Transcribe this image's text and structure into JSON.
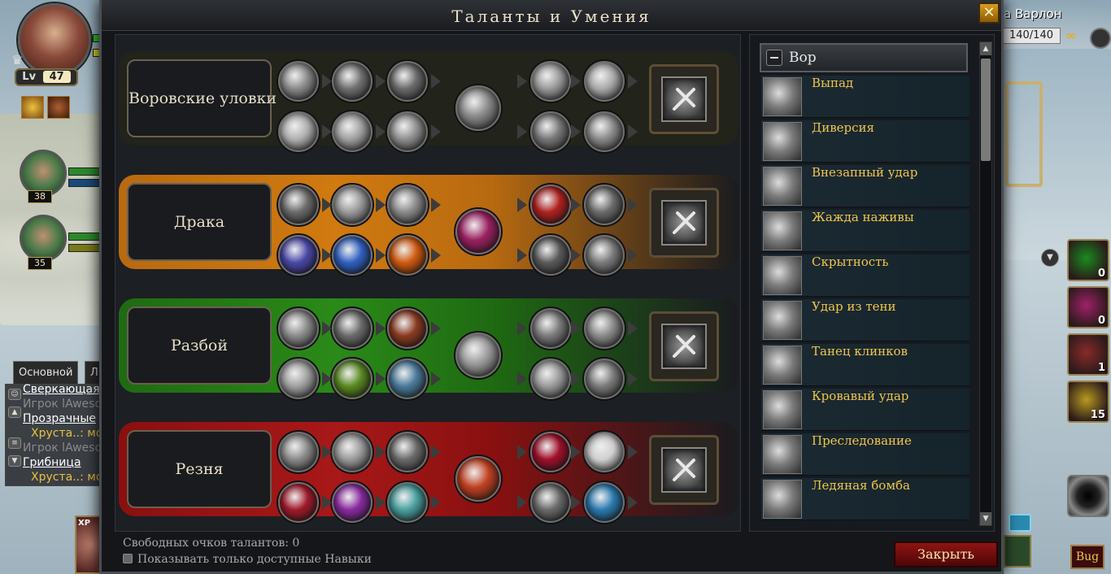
{
  "window": {
    "title": "Таланты и Умения",
    "close_glyph": "✕"
  },
  "player": {
    "level_prefix": "Lv",
    "level": "47"
  },
  "party": [
    {
      "level": "38"
    },
    {
      "level": "35"
    }
  ],
  "top_right": {
    "name_fragment": "а Варлон",
    "hp": "140/140"
  },
  "chat": {
    "tabs": [
      "Основной",
      "Л"
    ],
    "lines": [
      {
        "text": "Сверкающая",
        "color": "#ffffff",
        "underline": true
      },
      {
        "text": "Игрок lAweso",
        "color": "#8a8a8a",
        "underline": false
      },
      {
        "text": "Прозрачные",
        "color": "#ffffff",
        "underline": true
      },
      {
        "text": "Хруста..: мор",
        "color": "#e8c040",
        "underline": false
      },
      {
        "text": "Игрок lAweso",
        "color": "#8a8a8a",
        "underline": false
      },
      {
        "text": "Грибница",
        "color": "#ffffff",
        "underline": true
      },
      {
        "text": "Хруста..: мор",
        "color": "#e8c040",
        "underline": false
      }
    ]
  },
  "talent_trees": [
    {
      "name": "Воровские уловки",
      "color": "#2a2a1e",
      "accent": "#4b4a28"
    },
    {
      "name": "Драка",
      "color": "#b86a10",
      "accent": "#d07a10"
    },
    {
      "name": "Разбой",
      "color": "#1f6a12",
      "accent": "#2a8a18"
    },
    {
      "name": "Резня",
      "color": "#8a1010",
      "accent": "#a81818"
    }
  ],
  "footer": {
    "free_points": "Свободных очков талантов: 0",
    "only_available": "Показывать только доступные Навыки",
    "close_button": "Закрыть"
  },
  "skills_panel": {
    "class_name": "Вор",
    "skills": [
      "Выпад",
      "Диверсия",
      "Внезапный удар",
      "Жажда наживы",
      "Скрытность",
      "Удар из тени",
      "Танец клинков",
      "Кровавый удар",
      "Преследование",
      "Ледяная бомба"
    ]
  },
  "right_slots": [
    {
      "count": "0",
      "color": "#1a8a20"
    },
    {
      "count": "0",
      "color": "#a0206a"
    },
    {
      "count": "1",
      "color": "#8a2a2a"
    },
    {
      "count": "15",
      "color": "#b89a20"
    }
  ],
  "bug_button": "Bug",
  "xp_label": "XP",
  "colors": {
    "gold": "#f0c64a",
    "panel": "#14161a"
  }
}
